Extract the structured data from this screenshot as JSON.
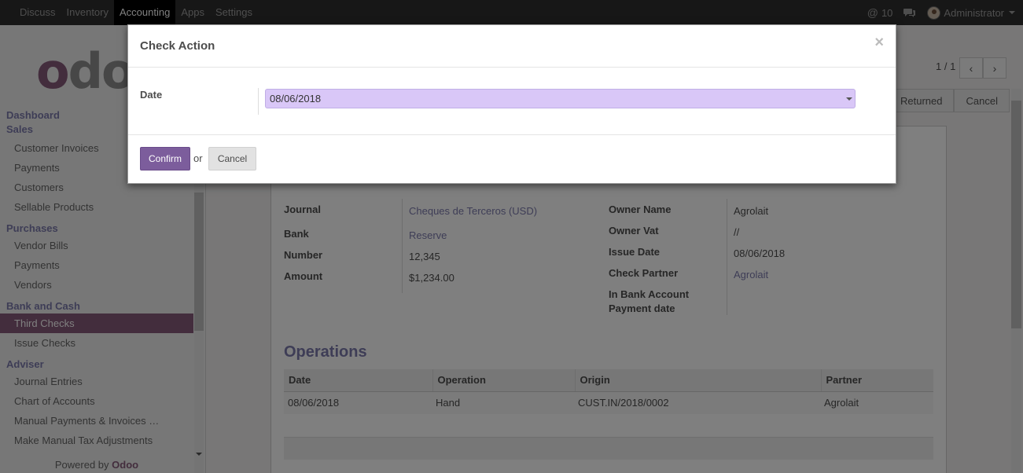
{
  "topbar": {
    "menu": [
      "Discuss",
      "Inventory",
      "Accounting",
      "Apps",
      "Settings"
    ],
    "active_menu": "Accounting",
    "mentions_count": "10",
    "user_name": "Administrator"
  },
  "sidebar": {
    "logo_first": "o",
    "logo_rest": "do",
    "sections": [
      {
        "title": "Dashboard",
        "items": []
      },
      {
        "title": "Sales",
        "items": [
          "Customer Invoices",
          "Payments",
          "Customers",
          "Sellable Products"
        ]
      },
      {
        "title": "Purchases",
        "items": [
          "Vendor Bills",
          "Payments",
          "Vendors"
        ]
      },
      {
        "title": "Bank and Cash",
        "items": [
          "Third Checks",
          "Issue Checks"
        ]
      },
      {
        "title": "Adviser",
        "items": [
          "Journal Entries",
          "Chart of Accounts",
          "Manual Payments & Invoices …",
          "Make Manual Tax Adjustments"
        ]
      }
    ],
    "active_item": "Third Checks",
    "powered_prefix": "Powered by ",
    "powered_brand": "Odoo"
  },
  "content": {
    "pager": "1 / 1",
    "status_buttons": [
      "Returned",
      "Cancel"
    ],
    "left_fields": [
      {
        "label": "Journal",
        "value": "Cheques de Terceros (USD)",
        "link": true
      },
      {
        "label": "Bank",
        "value": "Reserve",
        "link": true
      },
      {
        "label": "Number",
        "value": "12,345",
        "link": false
      },
      {
        "label": "Amount",
        "value": "$1,234.00",
        "link": false
      }
    ],
    "right_fields": [
      {
        "label": "Owner Name",
        "value": "Agrolait",
        "link": false
      },
      {
        "label": "Owner Vat",
        "value": "//",
        "link": false
      },
      {
        "label": "Issue Date",
        "value": "08/06/2018",
        "link": false
      },
      {
        "label": "Check Partner",
        "value": "Agrolait",
        "link": true
      },
      {
        "label": "In Bank Account",
        "value": "",
        "link": false
      },
      {
        "label": "Payment date",
        "value": "",
        "link": false
      }
    ],
    "operations_title": "Operations",
    "operations_columns": [
      "Date",
      "Operation",
      "Origin",
      "Partner"
    ],
    "operations_rows": [
      [
        "08/06/2018",
        "Hand",
        "CUST.IN/2018/0002",
        "Agrolait"
      ]
    ]
  },
  "modal": {
    "title": "Check Action",
    "close_symbol": "×",
    "date_label": "Date",
    "date_value": "08/06/2018",
    "confirm_label": "Confirm",
    "or_text": "or",
    "cancel_label": "Cancel"
  }
}
